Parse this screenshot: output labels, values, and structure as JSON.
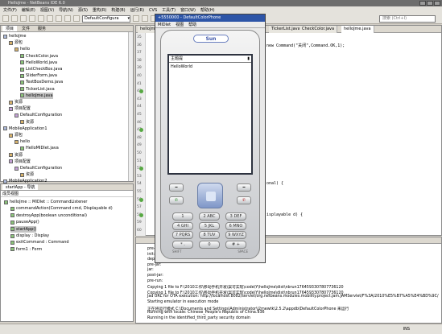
{
  "window": {
    "title": "HelloJme - NetBeans IDE 6.0"
  },
  "menubar": [
    "文件(F)",
    "编辑(E)",
    "视图(V)",
    "导航(N)",
    "源(S)",
    "重构(R)",
    "构建(B)",
    "运行(R)",
    "CVS",
    "工具(T)",
    "窗口(W)",
    "帮助(H)"
  ],
  "toolbar": {
    "config_value": "DefaultConfigura",
    "search_placeholder": "搜索 (Ctrl+I)"
  },
  "project_panel": {
    "tabs": [
      "项目",
      "文件",
      "服务"
    ],
    "tree": [
      {
        "label": "helloJme",
        "kind": "proj",
        "indent": 0
      },
      {
        "label": "源包",
        "kind": "pkg",
        "indent": 1
      },
      {
        "label": "hello",
        "kind": "pkg",
        "indent": 2
      },
      {
        "label": "CheckColor.java",
        "kind": "java",
        "indent": 3
      },
      {
        "label": "HelloWorld.java",
        "kind": "java",
        "indent": 3
      },
      {
        "label": "ListCheckBox.java",
        "kind": "java",
        "indent": 3
      },
      {
        "label": "SliderForm.java",
        "kind": "java",
        "indent": 3
      },
      {
        "label": "TextBoxDemo.java",
        "kind": "java",
        "indent": 3
      },
      {
        "label": "TickerList.java",
        "kind": "java",
        "indent": 3
      },
      {
        "label": "helloJme.java",
        "kind": "java",
        "indent": 3,
        "selected": true
      },
      {
        "label": "资源",
        "kind": "pkg",
        "indent": 1
      },
      {
        "label": "项目配置",
        "kind": "cfg",
        "indent": 1
      },
      {
        "label": "DefaultConfiguration",
        "kind": "cfg",
        "indent": 2
      },
      {
        "label": "资源",
        "kind": "pkg",
        "indent": 3
      },
      {
        "label": "MobileApplication1",
        "kind": "proj",
        "indent": 0
      },
      {
        "label": "源包",
        "kind": "pkg",
        "indent": 1
      },
      {
        "label": "hello",
        "kind": "pkg",
        "indent": 2
      },
      {
        "label": "HelloMIDlet.java",
        "kind": "java",
        "indent": 3
      },
      {
        "label": "资源",
        "kind": "pkg",
        "indent": 1
      },
      {
        "label": "项目配置",
        "kind": "cfg",
        "indent": 1
      },
      {
        "label": "DefaultConfiguration",
        "kind": "cfg",
        "indent": 2
      },
      {
        "label": "资源",
        "kind": "pkg",
        "indent": 3
      },
      {
        "label": "MobileApplication2",
        "kind": "proj",
        "indent": 0
      }
    ]
  },
  "navigator": {
    "title": "startApp - 导航",
    "section": "成员视图",
    "items": [
      {
        "label": "helloJme :: MIDlet :: CommandListener",
        "indent": 0
      },
      {
        "label": "commandAction(Command cmd, Displayable d)",
        "indent": 1
      },
      {
        "label": "destroyApp(boolean unconditional)",
        "indent": 1
      },
      {
        "label": "pauseApp()",
        "indent": 1
      },
      {
        "label": "startApp()",
        "indent": 1,
        "selected": true
      },
      {
        "label": "display : Display",
        "indent": 1
      },
      {
        "label": "exitCommand : Command",
        "indent": 1
      },
      {
        "label": "form1 : Form",
        "indent": 1
      }
    ]
  },
  "editor": {
    "tabs": [
      "helloJme.java",
      "TickerList.java",
      "CheckColor.java",
      "helloJme.java"
    ],
    "line_numbers": [
      "35",
      "36",
      "37",
      "38",
      "39",
      "40",
      "41",
      "42",
      "43",
      "44",
      "45",
      "46",
      "47",
      "48",
      "49",
      "50",
      "51",
      "52",
      "53",
      "54",
      "55",
      "56",
      "57",
      "58",
      "59",
      "60"
    ],
    "code_lines": [
      {
        "text": "new Command(\"关闭\",Command.OK,1);",
        "line": 1
      },
      {
        "text": "onal) {",
        "line": 19
      },
      {
        "text": "isplayable d) {",
        "line": 23
      }
    ]
  },
  "emulator": {
    "title": "+5550000 - DefaultColorPhone",
    "menu": [
      "MIDlet",
      "视图",
      "帮助"
    ],
    "brand": "Sun",
    "screen_title": "主题提",
    "screen_text": "HelloWorld",
    "soft_left": "SHIFT",
    "soft_right": "SPACE",
    "keys": [
      "1",
      "2 ABC",
      "3 DEF",
      "4 GHI",
      "5 JKL",
      "6 MNO",
      "7 PQRS",
      "8 TUV",
      "9 WXYZ",
      "* .",
      "0",
      "# +"
    ]
  },
  "output": {
    "lines": [
      "pre-init:",
      "init:",
      "deps-jar:",
      "pre-jar:",
      "jar:",
      "post-jar:",
      "pre-run:",
      "Copying 1 file to F:\\2010工作\\移动手机开发\\案可实现\\code\\Y\\helloJme\\dist\\nbrun1764593307807736120",
      "Copying 1 file to F:\\2010工作\\移动手机开发\\案可实现\\code\\Y\\helloJme\\dist\\nbrun1764593307807736120",
      "Jad URL for OTA execution: http://localhost:8082/servlet/org.netbeans.modules.mobility.project.jam.JAMServlet/F%3A/2010%E5%B7%A5%E4%BD%9C/",
      "Starting emulator in execution mode",
      "正在将运行模式 C:\\Documents and Settings\\Administrator\\j2mewtk\\2.5.2\\appdb\\DefaultColorPhone 来运行",
      "Running with locale: Chinese_People's Republic of China.936",
      "Running in the identified_third_party security domain"
    ]
  },
  "status": {
    "text": "INS"
  }
}
